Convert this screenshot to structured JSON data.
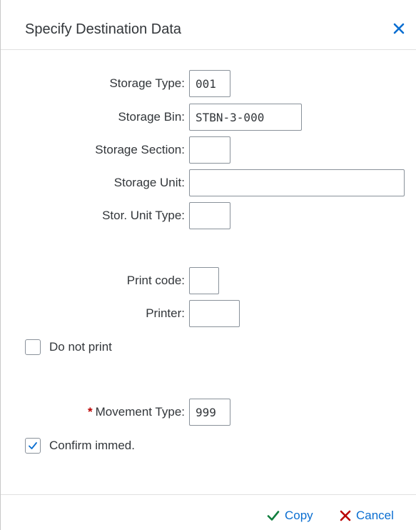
{
  "dialog": {
    "title": "Specify Destination Data"
  },
  "fields": {
    "storage_type": {
      "label": "Storage Type:",
      "value": "001"
    },
    "storage_bin": {
      "label": "Storage Bin:",
      "value": "STBN-3-000"
    },
    "storage_section": {
      "label": "Storage Section:",
      "value": ""
    },
    "storage_unit": {
      "label": "Storage Unit:",
      "value": ""
    },
    "stor_unit_type": {
      "label": "Stor. Unit Type:",
      "value": ""
    },
    "print_code": {
      "label": "Print code:",
      "value": ""
    },
    "printer": {
      "label": "Printer:",
      "value": ""
    },
    "movement_type": {
      "label": "Movement Type:",
      "value": "999",
      "required_marker": "*"
    }
  },
  "checkboxes": {
    "do_not_print": {
      "label": "Do not print",
      "checked": false
    },
    "confirm_immed": {
      "label": "Confirm immed.",
      "checked": true
    }
  },
  "footer": {
    "copy_label": "Copy",
    "cancel_label": "Cancel"
  },
  "colors": {
    "accent": "#0a6ed1",
    "copy_icon": "#107e3e",
    "cancel_icon": "#bb0000",
    "required": "#bb0000"
  },
  "icons": {
    "close": "close-icon",
    "copy": "checkmark-icon",
    "cancel": "cross-icon",
    "checkbox_check": "check-icon"
  }
}
